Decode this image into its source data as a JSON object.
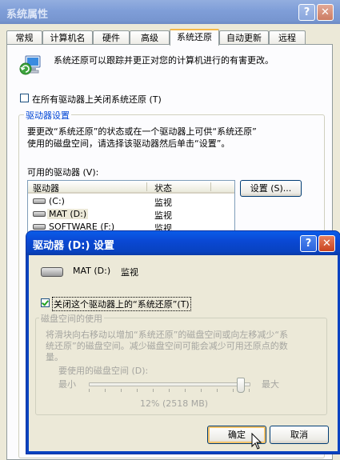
{
  "main_window": {
    "title": "系统属性",
    "tabs": [
      "常规",
      "计算机名",
      "硬件",
      "高级",
      "系统还原",
      "自动更新",
      "远程"
    ],
    "active_tab": "系统还原",
    "intro_text": "系统还原可以跟踪并更正对您的计算机进行的有害更改。",
    "disable_all_label": "在所有驱动器上关闭系统还原 (T)",
    "drive_settings": {
      "group_title": "驱动器设置",
      "description_line1": "要更改“系统还原”的状态或在一个驱动器上可供“系统还原”",
      "description_line2": "使用的磁盘空间，请选择该驱动器然后单击“设置”。",
      "available_label": "可用的驱动器 (V):",
      "columns": [
        "驱动器",
        "状态"
      ],
      "drives": [
        {
          "name": "(C:)",
          "status": "监视"
        },
        {
          "name": "MAT (D:)",
          "status": "监视"
        },
        {
          "name": "SOFTWARE (F:)",
          "status": "监视"
        }
      ],
      "settings_button": "设置 (S)..."
    }
  },
  "dialog": {
    "title": "驱动器 (D:) 设置",
    "drive_name": "MAT (D:)",
    "drive_status": "监视",
    "turn_off_label": "关闭这个驱动器上的“系统还原”(T)",
    "turn_off_checked": true,
    "disk_group_title": "磁盘空间的使用",
    "disk_desc_line1": "将滑块向右移动以增加“系统还原”的磁盘空间或向左移减少“系",
    "disk_desc_line2": "统还原”的磁盘空间。减少磁盘空间可能会减少可用还原点的数",
    "disk_desc_line3": "量。",
    "usage_label": "要使用的磁盘空间 (D):",
    "min_label": "最小",
    "max_label": "最大",
    "slider_value": 0.95,
    "usage_value": "12% (2518 MB)",
    "ok_button": "确定",
    "cancel_button": "取消"
  }
}
